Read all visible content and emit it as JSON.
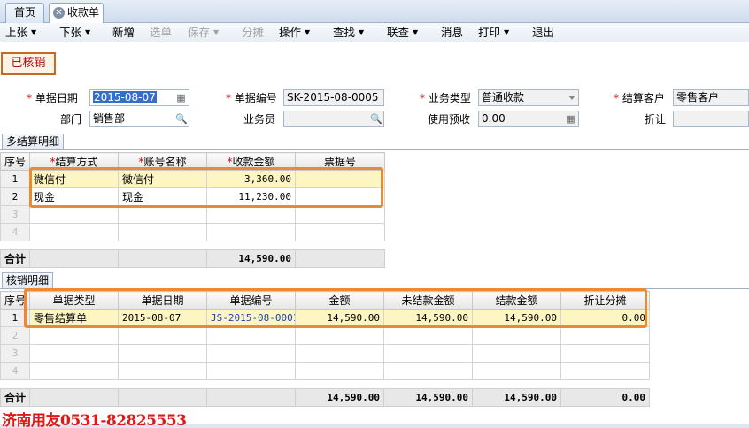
{
  "tabs": {
    "home": "首页",
    "active": "收款单"
  },
  "toolbar": {
    "prev": "上张",
    "next": "下张",
    "add": "新增",
    "select": "选单",
    "save": "保存",
    "allocate": "分摊",
    "operate": "操作",
    "find": "查找",
    "linked": "联查",
    "message": "消息",
    "print": "打印",
    "exit": "退出"
  },
  "status": "已核销",
  "header": {
    "date_label": "单据日期",
    "date_value": "2015-08-07",
    "no_label": "单据编号",
    "no_value": "SK-2015-08-0005",
    "biz_type_label": "业务类型",
    "biz_type_value": "普通收款",
    "customer_label": "结算客户",
    "customer_value": "零售客户",
    "dept_label": "部门",
    "dept_value": "销售部",
    "staff_label": "业务员",
    "staff_value": "",
    "prepay_label": "使用预收",
    "prepay_value": "0.00",
    "discount_label": "折让",
    "discount_value": ""
  },
  "settle": {
    "tab": "多结算明细",
    "columns": [
      "序号",
      "结算方式",
      "账号名称",
      "收款金额",
      "票据号"
    ],
    "required": [
      false,
      true,
      true,
      true,
      false
    ],
    "rows": [
      {
        "idx": "1",
        "method": "微信付",
        "account": "微信付",
        "amount": "3,360.00",
        "bill": ""
      },
      {
        "idx": "2",
        "method": "现金",
        "account": "现金",
        "amount": "11,230.00",
        "bill": ""
      },
      {
        "idx": "3",
        "method": "",
        "account": "",
        "amount": "",
        "bill": ""
      },
      {
        "idx": "4",
        "method": "",
        "account": "",
        "amount": "",
        "bill": ""
      }
    ],
    "total_label": "合计",
    "total_amount": "14,590.00"
  },
  "writeoff": {
    "tab": "核销明细",
    "columns": [
      "序号",
      "单据类型",
      "单据日期",
      "单据编号",
      "金额",
      "未结款金额",
      "结款金额",
      "折让分摊"
    ],
    "rows": [
      {
        "idx": "1",
        "type": "零售结算单",
        "date": "2015-08-07",
        "no": "JS-2015-08-0001",
        "amount": "14,590.00",
        "unpaid": "14,590.00",
        "paid": "14,590.00",
        "discount": "0.00"
      },
      {
        "idx": "2",
        "type": "",
        "date": "",
        "no": "",
        "amount": "",
        "unpaid": "",
        "paid": "",
        "discount": ""
      },
      {
        "idx": "3",
        "type": "",
        "date": "",
        "no": "",
        "amount": "",
        "unpaid": "",
        "paid": "",
        "discount": ""
      },
      {
        "idx": "4",
        "type": "",
        "date": "",
        "no": "",
        "amount": "",
        "unpaid": "",
        "paid": "",
        "discount": ""
      }
    ],
    "total_label": "合计",
    "total_amount": "14,590.00",
    "total_unpaid": "14,590.00",
    "total_paid": "14,590.00",
    "total_discount": "0.00"
  },
  "watermark": "济南用友0531-82825553",
  "colors": {
    "highlight_row": "#fdf5c2",
    "annotation_box": "#f0892e",
    "status_red": "#b01010"
  },
  "icons": {
    "close": "close-icon",
    "calendar": "calendar-icon",
    "search": "magnifier-icon",
    "dropdown": "chevron-down-icon"
  }
}
